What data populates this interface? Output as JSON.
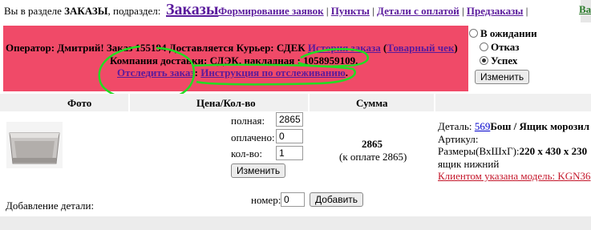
{
  "topbar": {
    "prefix": "Вы в разделе ",
    "section": "ЗАКАЗЫ",
    "subsection_label": ", подраздел:",
    "subsection": "Заказы",
    "nav": [
      "Формирование заявок",
      "Пункты",
      "Детали с оплатой",
      "Предзаказы"
    ],
    "cut_link": "Ва"
  },
  "order": {
    "line1": "Оператор: Дмитрий! Заказ 155194 Доставляется Курьер: СДЕК ",
    "history_link": "История заказа",
    "receipt_link": "Товарный чек",
    "line2": "Компания доставки: СДЭК. накладная : 1058959109.",
    "track_link": "Отследить заказ",
    "instruction_link": "Инструкция по отслеживанию"
  },
  "status": {
    "options": [
      {
        "label": "В ожидании",
        "checked": false
      },
      {
        "label": "Отказ",
        "checked": false
      },
      {
        "label": "Успех",
        "checked": true
      }
    ],
    "change_button": "Изменить"
  },
  "table": {
    "headers": [
      "Фото",
      "Цена/Кол-во",
      "Сумма"
    ]
  },
  "item": {
    "price_label": "полная:",
    "price_value": "2865",
    "paid_label": "оплачено:",
    "paid_value": "0",
    "qty_label": "кол-во:",
    "qty_value": "1",
    "change_button": "Изменить",
    "sum": "2865",
    "sum_paid": "(к оплате 2865)",
    "detail_label": "Деталь: ",
    "detail_id": "569",
    "detail_name": "Бош / Ящик морозил",
    "article_label": "Артикул:",
    "size_label": "Размеры(ВхШхГ):",
    "size_value": "220 х 430 х 230",
    "extra": "ящик нижний",
    "client_model": "Клиентом указана модель: KGN36"
  },
  "add_detail": {
    "label": "Добавление детали:",
    "number_label": "номер:",
    "number_value": "0",
    "button": "Добавить"
  },
  "colors": {
    "panel": "#f04a68",
    "link_purple": "#5a1a9c",
    "annotation_green": "#22dd22"
  }
}
